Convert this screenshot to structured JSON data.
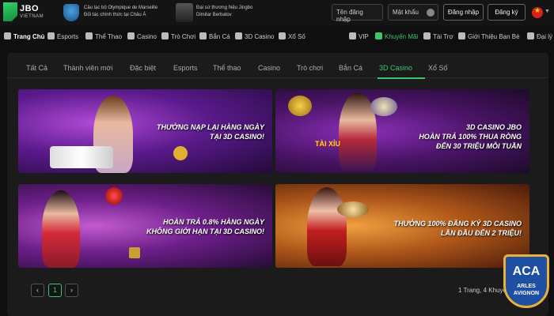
{
  "header": {
    "logo_text": "JBO",
    "logo_sub": "VIETNAM",
    "partner1_line1": "Câu lạc bộ Olympique de Marseille",
    "partner1_line2": "Đối tác chính thức tại Châu Á",
    "partner2_line1": "Đại sứ thương hiệu Jingbo",
    "partner2_line2": "Dimitar Berbatov",
    "username_placeholder": "Tên đăng nhập",
    "password_placeholder": "Mật khẩu",
    "login_label": "Đăng nhập",
    "register_label": "Đăng ký"
  },
  "nav": {
    "home": "Trang Chủ",
    "esports": "Esports",
    "sports": "Thể Thao",
    "casino": "Casino",
    "games": "Trò Chơi",
    "fishing": "Bắn Cá",
    "casino3d": "3D Casino",
    "lottery": "Xổ Số",
    "vip": "VIP",
    "promotions": "Khuyến Mãi",
    "sponsor": "Tài Trợ",
    "refer": "Giới Thiệu Bạn Bè",
    "agent": "Đại lý"
  },
  "tabs": [
    "Tất Cả",
    "Thành viên mới",
    "Đặc biệt",
    "Esports",
    "Thể thao",
    "Casino",
    "Trò chơi",
    "Bắn Cá",
    "3D Casino",
    "Xổ Số"
  ],
  "active_tab": "3D Casino",
  "promos": [
    {
      "line1": "THƯỞNG NẠP LẠI HÀNG NGÀY",
      "line2": "TẠI 3D CASINO!"
    },
    {
      "line1": "3D CASINO JBO",
      "line2": "HOÀN TRẢ 100% THUA RÒNG",
      "line3": "ĐẾN 30 TRIỆU MỖI TUẦN",
      "tag": "TÀI XỈU"
    },
    {
      "line1": "HOÀN TRẢ 0.8% HÀNG NGÀY",
      "line2": "KHÔNG GIỚI HẠN TẠI 3D CASINO!"
    },
    {
      "line1": "THƯỞNG 100% ĐĂNG KÝ 3D CASINO",
      "line2": "LẦN ĐẦU ĐẾN 2 TRIỆU!"
    }
  ],
  "pagination": {
    "prev": "‹",
    "current": "1",
    "next": "›",
    "info": "1 Trang, 4 Khuyến Mãi"
  },
  "badge": {
    "abbr": "ACA",
    "name1": "ARLES",
    "name2": "AVIGNON"
  },
  "colors": {
    "accent": "#3ec46d",
    "background": "#0f0f0f",
    "panel": "#1b1b1b"
  }
}
